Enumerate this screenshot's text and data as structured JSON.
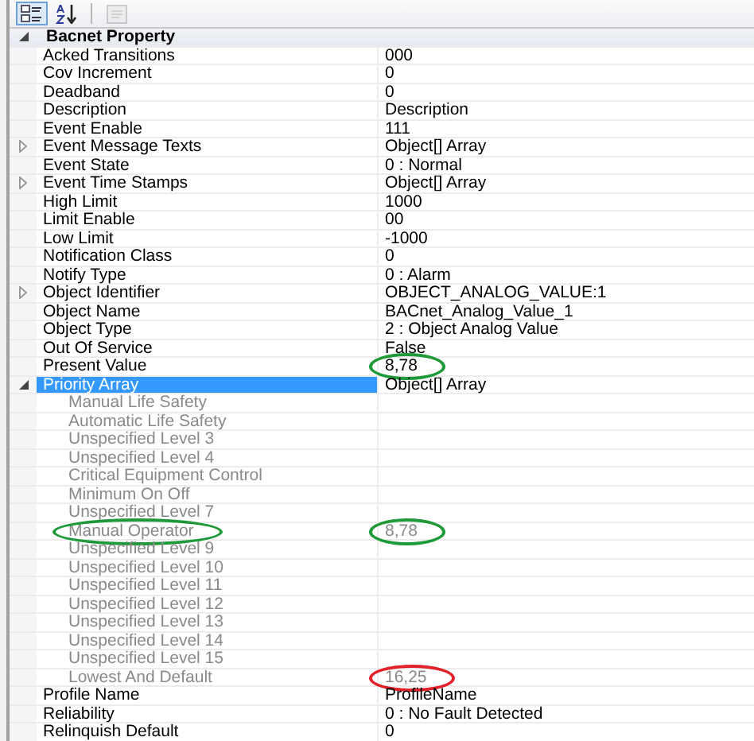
{
  "toolbar": {
    "buttons": [
      {
        "kind": "categorized",
        "selected": true,
        "disabled": false
      },
      {
        "kind": "alphabetical",
        "selected": false,
        "disabled": false
      },
      {
        "kind": "property_pages",
        "selected": false,
        "disabled": true
      }
    ]
  },
  "category": {
    "name": "Bacnet Property",
    "expanded": true
  },
  "properties": [
    {
      "name": "Acked Transitions",
      "value": "000",
      "selected": false
    },
    {
      "name": "Cov Increment",
      "value": "0",
      "selected": false
    },
    {
      "name": "Deadband",
      "value": "0",
      "selected": false
    },
    {
      "name": "Description",
      "value": "Description",
      "selected": false
    },
    {
      "name": "Event Enable",
      "value": "111",
      "selected": false
    },
    {
      "name": "Event Message Texts",
      "value": "Object[] Array",
      "selected": false,
      "expanded": false
    },
    {
      "name": "Event State",
      "value": "0 : Normal",
      "selected": false
    },
    {
      "name": "Event Time Stamps",
      "value": "Object[] Array",
      "selected": false,
      "expanded": false
    },
    {
      "name": "High Limit",
      "value": "1000",
      "selected": false
    },
    {
      "name": "Limit Enable",
      "value": "00",
      "selected": false
    },
    {
      "name": "Low Limit",
      "value": "-1000",
      "selected": false
    },
    {
      "name": "Notification Class",
      "value": "0",
      "selected": false
    },
    {
      "name": "Notify Type",
      "value": "0 : Alarm",
      "selected": false
    },
    {
      "name": "Object Identifier",
      "value": "OBJECT_ANALOG_VALUE:1",
      "selected": false,
      "expanded": false
    },
    {
      "name": "Object Name",
      "value": "BACnet_Analog_Value_1",
      "selected": false
    },
    {
      "name": "Object Type",
      "value": "2 : Object Analog Value",
      "selected": false
    },
    {
      "name": "Out Of Service",
      "value": "False",
      "selected": false
    },
    {
      "name": "Present Value",
      "value": "8,78",
      "selected": false,
      "value_circle": {
        "color": "#1f9a3a"
      }
    },
    {
      "name": "Priority Array",
      "value": "Object[] Array",
      "selected": true,
      "expanded": true,
      "children": [
        {
          "name": "Manual Life Safety",
          "disabled": true
        },
        {
          "name": "Automatic Life Safety",
          "disabled": true
        },
        {
          "name": "Unspecified Level 3",
          "disabled": true
        },
        {
          "name": "Unspecified Level 4",
          "disabled": true
        },
        {
          "name": "Critical Equipment Control",
          "disabled": true
        },
        {
          "name": "Minimum On Off",
          "disabled": true
        },
        {
          "name": "Unspecified Level 7",
          "disabled": true
        },
        {
          "name": "Manual Operator",
          "value": "8,78",
          "disabled": true,
          "name_circle": {
            "color": "#1f9a3a"
          },
          "value_circle": {
            "color": "#1f9a3a"
          }
        },
        {
          "name": "Unspecified Level 9",
          "disabled": true
        },
        {
          "name": "Unspecified Level 10",
          "disabled": true
        },
        {
          "name": "Unspecified Level 11",
          "disabled": true
        },
        {
          "name": "Unspecified Level 12",
          "disabled": true
        },
        {
          "name": "Unspecified Level 13",
          "disabled": true
        },
        {
          "name": "Unspecified Level 14",
          "disabled": true
        },
        {
          "name": "Unspecified Level 15",
          "disabled": true
        },
        {
          "name": "Lowest And Default",
          "value": "16,25",
          "disabled": true,
          "value_circle": {
            "color": "#e2222a"
          }
        }
      ]
    },
    {
      "name": "Profile Name",
      "value": "ProfileName",
      "selected": false
    },
    {
      "name": "Reliability",
      "value": "0 : No Fault Detected",
      "selected": false
    },
    {
      "name": "Relinquish Default",
      "value": "0",
      "selected": false
    }
  ]
}
